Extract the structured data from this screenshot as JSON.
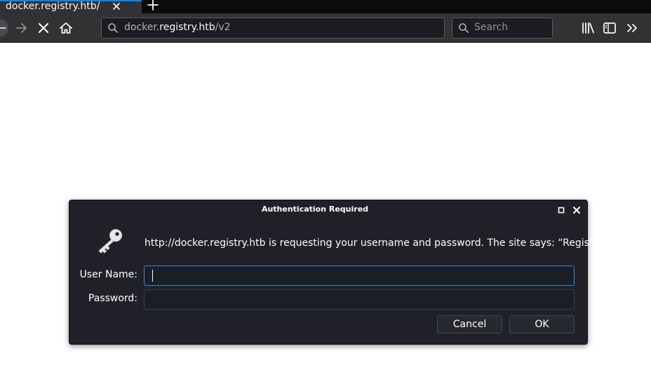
{
  "browser": {
    "tab": {
      "title": "docker.registry.htb/"
    },
    "url": {
      "host_prefix": "docker.",
      "host_main": "registry.htb",
      "path": "/v2"
    },
    "search": {
      "placeholder": "Search"
    }
  },
  "dialog": {
    "title": "Authentication Required",
    "message": "http://docker.registry.htb is requesting your username and password. The site says: “Registry”",
    "username_label": "User Name:",
    "username_value": "",
    "password_label": "Password:",
    "password_value": "",
    "cancel_label": "Cancel",
    "ok_label": "OK"
  },
  "colors": {
    "accent": "#0a84ff",
    "toolbar": "#323234",
    "dialog_bg": "#202128",
    "focus_border": "#3f83d6"
  }
}
